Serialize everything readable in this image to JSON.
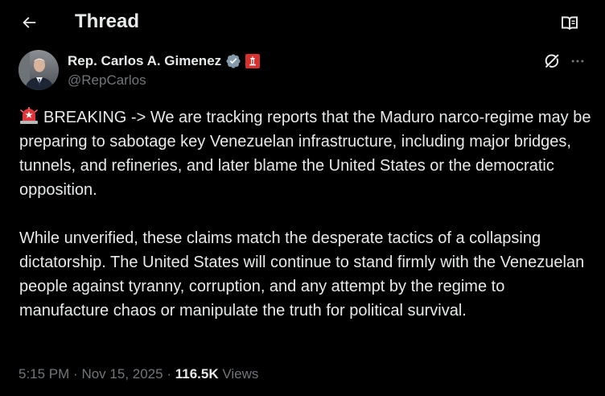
{
  "header": {
    "title": "Thread"
  },
  "author": {
    "name": "Rep. Carlos A. Gimenez",
    "handle": "@RepCarlos",
    "verified_color": "#829aab",
    "affiliation_badge_color": "#d6302f"
  },
  "tweet": {
    "paragraphs": [
      "BREAKING -> We are tracking  reports that the Maduro narco-regime may be preparing to sabotage key Venezuelan infrastructure, including major bridges, tunnels, and refineries, and later blame the United States or the democratic opposition.",
      "While unverified, these claims match the desperate tactics of a collapsing dictatorship. The United States will continue to stand firmly with the Venezuelan people against tyranny, corruption, and any attempt by the regime to manufacture chaos or manipulate the truth for political survival."
    ],
    "leading_icon": "police-siren-icon"
  },
  "meta": {
    "time": "5:15 PM",
    "separator": "·",
    "date": "Nov 15, 2025",
    "views_count": "116.5K",
    "views_label": "Views"
  },
  "colors": {
    "background": "#000000",
    "text_primary": "#e7e9ea",
    "text_secondary": "#71767b"
  }
}
